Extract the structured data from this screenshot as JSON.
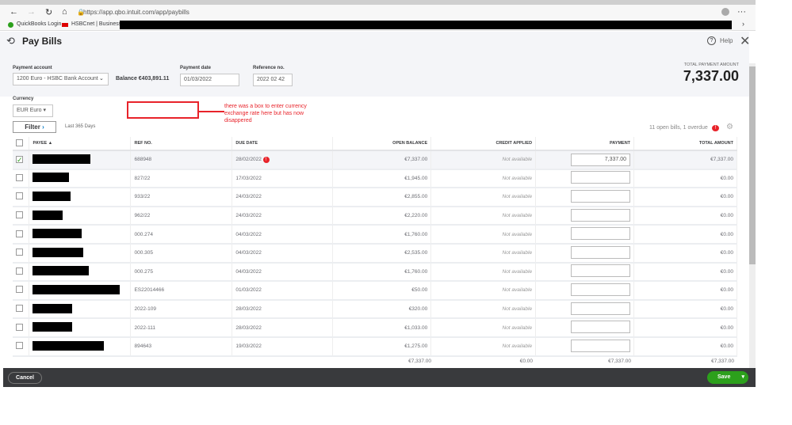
{
  "browser": {
    "url": "https://app.qbo.intuit.com/app/paybills",
    "bookmarks": [
      "QuickBooks Login",
      "HSBCnet | Business..."
    ]
  },
  "header": {
    "title": "Pay Bills",
    "help": "Help",
    "total_label": "TOTAL PAYMENT AMOUNT",
    "total_value": "7,337.00"
  },
  "form": {
    "payment_account_label": "Payment account",
    "payment_account": "1200 Euro - HSBC Bank Account",
    "balance": "Balance €403,891.11",
    "payment_date_label": "Payment date",
    "payment_date": "01/03/2022",
    "reference_label": "Reference no.",
    "reference": "2022 02 42",
    "currency_label": "Currency",
    "currency": "EUR Euro",
    "filter": "Filter",
    "filter_range": "Last 365 Days",
    "summary": "11 open bills, 1 overdue"
  },
  "annotation": {
    "text": "there was a box to enter currency exchange rate here but has now disappered",
    "color": "#e8232a"
  },
  "table": {
    "headers": [
      "PAYEE ▲",
      "REF NO.",
      "DUE DATE",
      "OPEN BALANCE",
      "CREDIT APPLIED",
      "PAYMENT",
      "TOTAL AMOUNT"
    ],
    "rows": [
      {
        "ref": "688948",
        "due": "28/02/2022",
        "open": "€7,337.00",
        "credit": "Not available",
        "payment": "7,337.00",
        "total": "€7,337.00",
        "checked": true,
        "overdue": true
      },
      {
        "ref": "827/22",
        "due": "17/03/2022",
        "open": "€1,945.00",
        "credit": "Not available",
        "payment": "",
        "total": "€0.00"
      },
      {
        "ref": "933/22",
        "due": "24/03/2022",
        "open": "€2,855.00",
        "credit": "Not available",
        "payment": "",
        "total": "€0.00"
      },
      {
        "ref": "962/22",
        "due": "24/03/2022",
        "open": "€2,220.00",
        "credit": "Not available",
        "payment": "",
        "total": "€0.00"
      },
      {
        "ref": "000.274",
        "due": "04/03/2022",
        "open": "€1,760.00",
        "credit": "Not available",
        "payment": "",
        "total": "€0.00"
      },
      {
        "ref": "000.305",
        "due": "04/03/2022",
        "open": "€2,535.00",
        "credit": "Not available",
        "payment": "",
        "total": "€0.00"
      },
      {
        "ref": "000.275",
        "due": "04/03/2022",
        "open": "€1,760.00",
        "credit": "Not available",
        "payment": "",
        "total": "€0.00"
      },
      {
        "ref": "ES22014466",
        "due": "01/03/2022",
        "open": "€50.00",
        "credit": "Not available",
        "payment": "",
        "total": "€0.00"
      },
      {
        "ref": "2022-109",
        "due": "28/03/2022",
        "open": "€320.00",
        "credit": "Not available",
        "payment": "",
        "total": "€0.00"
      },
      {
        "ref": "2022-111",
        "due": "28/03/2022",
        "open": "€1,033.00",
        "credit": "Not available",
        "payment": "",
        "total": "€0.00"
      },
      {
        "ref": "894643",
        "due": "19/03/2022",
        "open": "€1,275.00",
        "credit": "Not available",
        "payment": "",
        "total": "€0.00"
      }
    ],
    "totals": {
      "open": "€7,337.00",
      "credit": "€0.00",
      "payment": "€7,337.00",
      "total": "€7,337.00"
    }
  },
  "footer": {
    "cancel": "Cancel",
    "save": "Save"
  }
}
